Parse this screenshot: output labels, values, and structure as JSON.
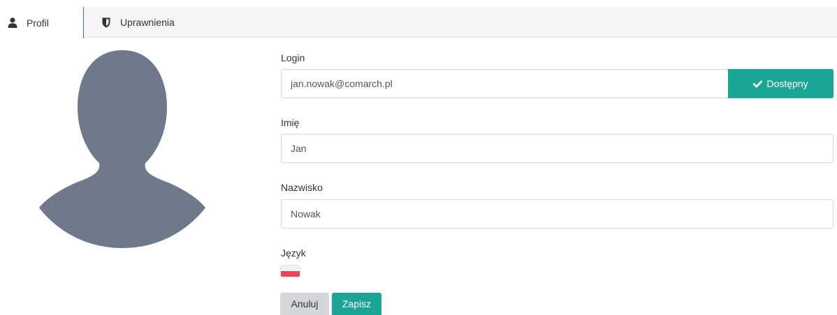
{
  "tabs": [
    {
      "label": "Profil",
      "icon": "user-icon",
      "active": true
    },
    {
      "label": "Uprawnienia",
      "icon": "shield-icon",
      "active": false
    }
  ],
  "avatar": {
    "icon": "user-silhouette-icon",
    "color": "#6e7a8a"
  },
  "form": {
    "login": {
      "label": "Login",
      "value": "jan.nowak@comarch.pl",
      "status_label": "Dostępny",
      "status_icon": "check-icon"
    },
    "first_name": {
      "label": "Imię",
      "value": "Jan"
    },
    "last_name": {
      "label": "Nazwisko",
      "value": "Nowak"
    },
    "language": {
      "label": "Język",
      "flag": "pl-flag-icon"
    }
  },
  "actions": {
    "cancel_label": "Anuluj",
    "save_label": "Zapisz"
  },
  "colors": {
    "accent": "#1ca594",
    "cancel": "#d3d7dc",
    "active_tab_border": "#2a6fb8"
  }
}
